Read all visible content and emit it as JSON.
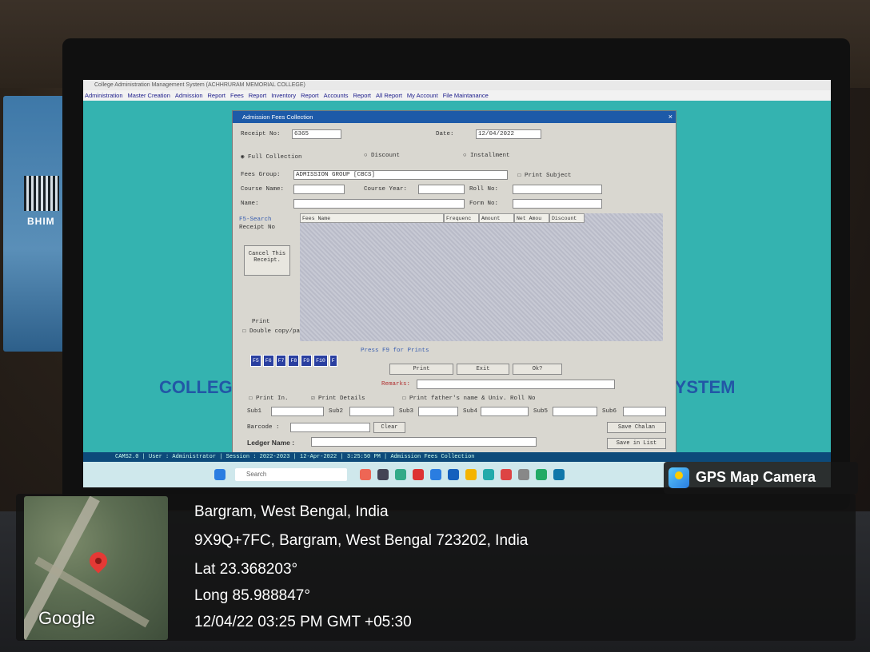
{
  "app": {
    "window_title": "College Administration Management System (ACHHRURAM MEMORIAL COLLEGE)",
    "menu": [
      "Administration",
      "Master Creation",
      "Admission",
      "Report",
      "Fees",
      "Report",
      "Inventory",
      "Report",
      "Accounts",
      "Report",
      "All Report",
      "My Account",
      "File Maintanance"
    ],
    "watermark_left": "COLLEG",
    "watermark_right": "SYSTEM"
  },
  "dialog": {
    "title": "Admission Fees Collection",
    "close_glyph": "×",
    "receipt_label": "Receipt No:",
    "receipt_value": "6365",
    "date_label": "Date:",
    "date_value": "12/04/2022",
    "radio_full": "Full Collection",
    "radio_discount": "Discount",
    "radio_installment": "Installment",
    "fees_group_label": "Fees Group:",
    "fees_group_value": "ADMISSION GROUP [CBCS]",
    "print_subject": "Print Subject",
    "course_name_label": "Course Name:",
    "course_year_label": "Course Year:",
    "roll_no_label": "Roll No:",
    "name_label": "Name:",
    "form_no_label": "Form No:",
    "search_label": "F5-Search",
    "receipt_no_label": "Receipt No",
    "grid_headers": [
      "Fees Name",
      "Frequenc",
      "Amount",
      "Net Amou",
      "Discount"
    ],
    "cancel_button": "Cancel This Receipt.",
    "print_double": "Print",
    "double_copy": "Double copy/page",
    "fkeys": [
      "F5",
      "F6",
      "F7",
      "F8",
      "F9",
      "F10",
      "F"
    ],
    "press_hint": "Press F9 for Prints",
    "print_button": "Print",
    "exit_button": "Exit",
    "ok_button": "Ok?",
    "remarks_label": "Remarks:",
    "print_in": "Print In.",
    "print_details": "Print Details",
    "print_father": "Print father's name & Univ. Roll No",
    "subjects": [
      "Sub1",
      "Sub2",
      "Sub3",
      "Sub4",
      "Sub5",
      "Sub6"
    ],
    "barcode_label": "Barcode :",
    "clear_button": "Clear",
    "save_chalan": "Save Chalan",
    "ledger_label": "Ledger Name :",
    "save_in_list": "Save in List"
  },
  "statusbar": {
    "text": "CAMS2.0 | User : Administrator | Session : 2022-2023 | 12-Apr-2022 | 3:25:50 PM | Admission Fees Collection"
  },
  "taskbar": {
    "search_placeholder": "Search"
  },
  "gps": {
    "app_name": "GPS Map Camera",
    "address_1": "Bargram, West Bengal, India",
    "address_2": "9X9Q+7FC, Bargram, West Bengal 723202, India",
    "lat": "Lat 23.368203°",
    "long": "Long 85.988847°",
    "datetime": "12/04/22 03:25 PM GMT +05:30",
    "map_brand": "Google"
  },
  "colors": {
    "desktop": "#34b3b0",
    "dialog_title": "#1d5aa8",
    "pin": "#e53935"
  }
}
